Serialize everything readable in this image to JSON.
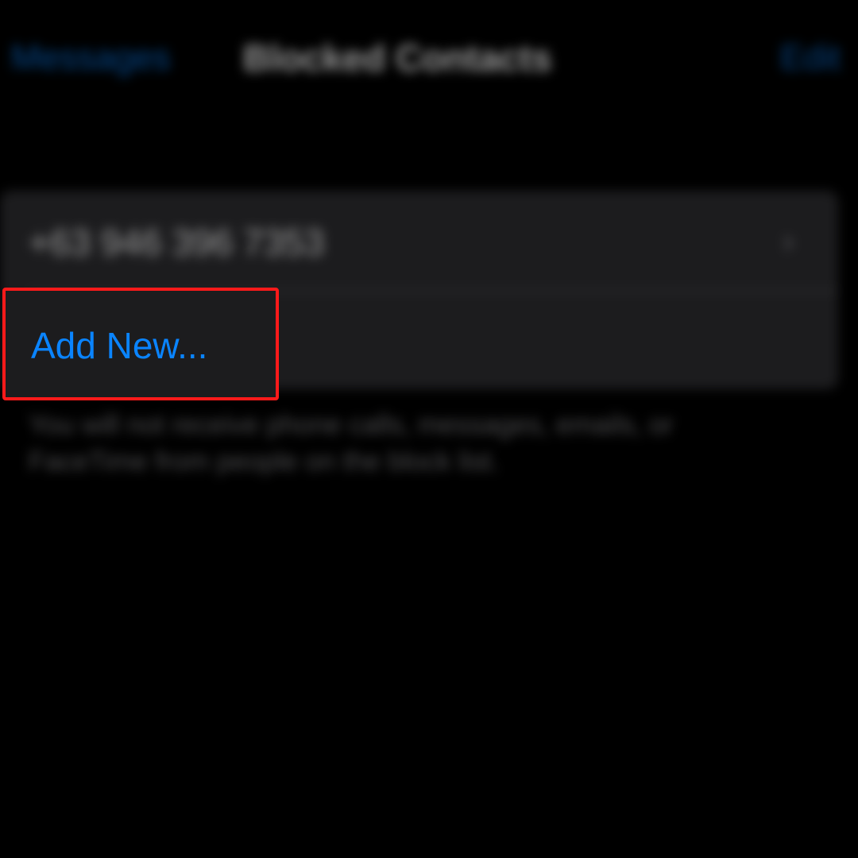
{
  "nav": {
    "back_label": "Messages",
    "title": "Blocked Contacts",
    "edit_label": "Edit"
  },
  "blocked_list": {
    "contacts": [
      {
        "number": "+63 946 396 7353"
      }
    ],
    "add_new_label": "Add New...",
    "footer": "You will not receive phone calls, messages, emails, or FaceTime from people on the block list."
  },
  "colors": {
    "accent": "#0a84ff",
    "highlight": "#ff1a1a",
    "cell_background": "#1c1c1e",
    "background": "#000000"
  },
  "icons": {
    "row_chevron": "chevron-right-icon"
  }
}
